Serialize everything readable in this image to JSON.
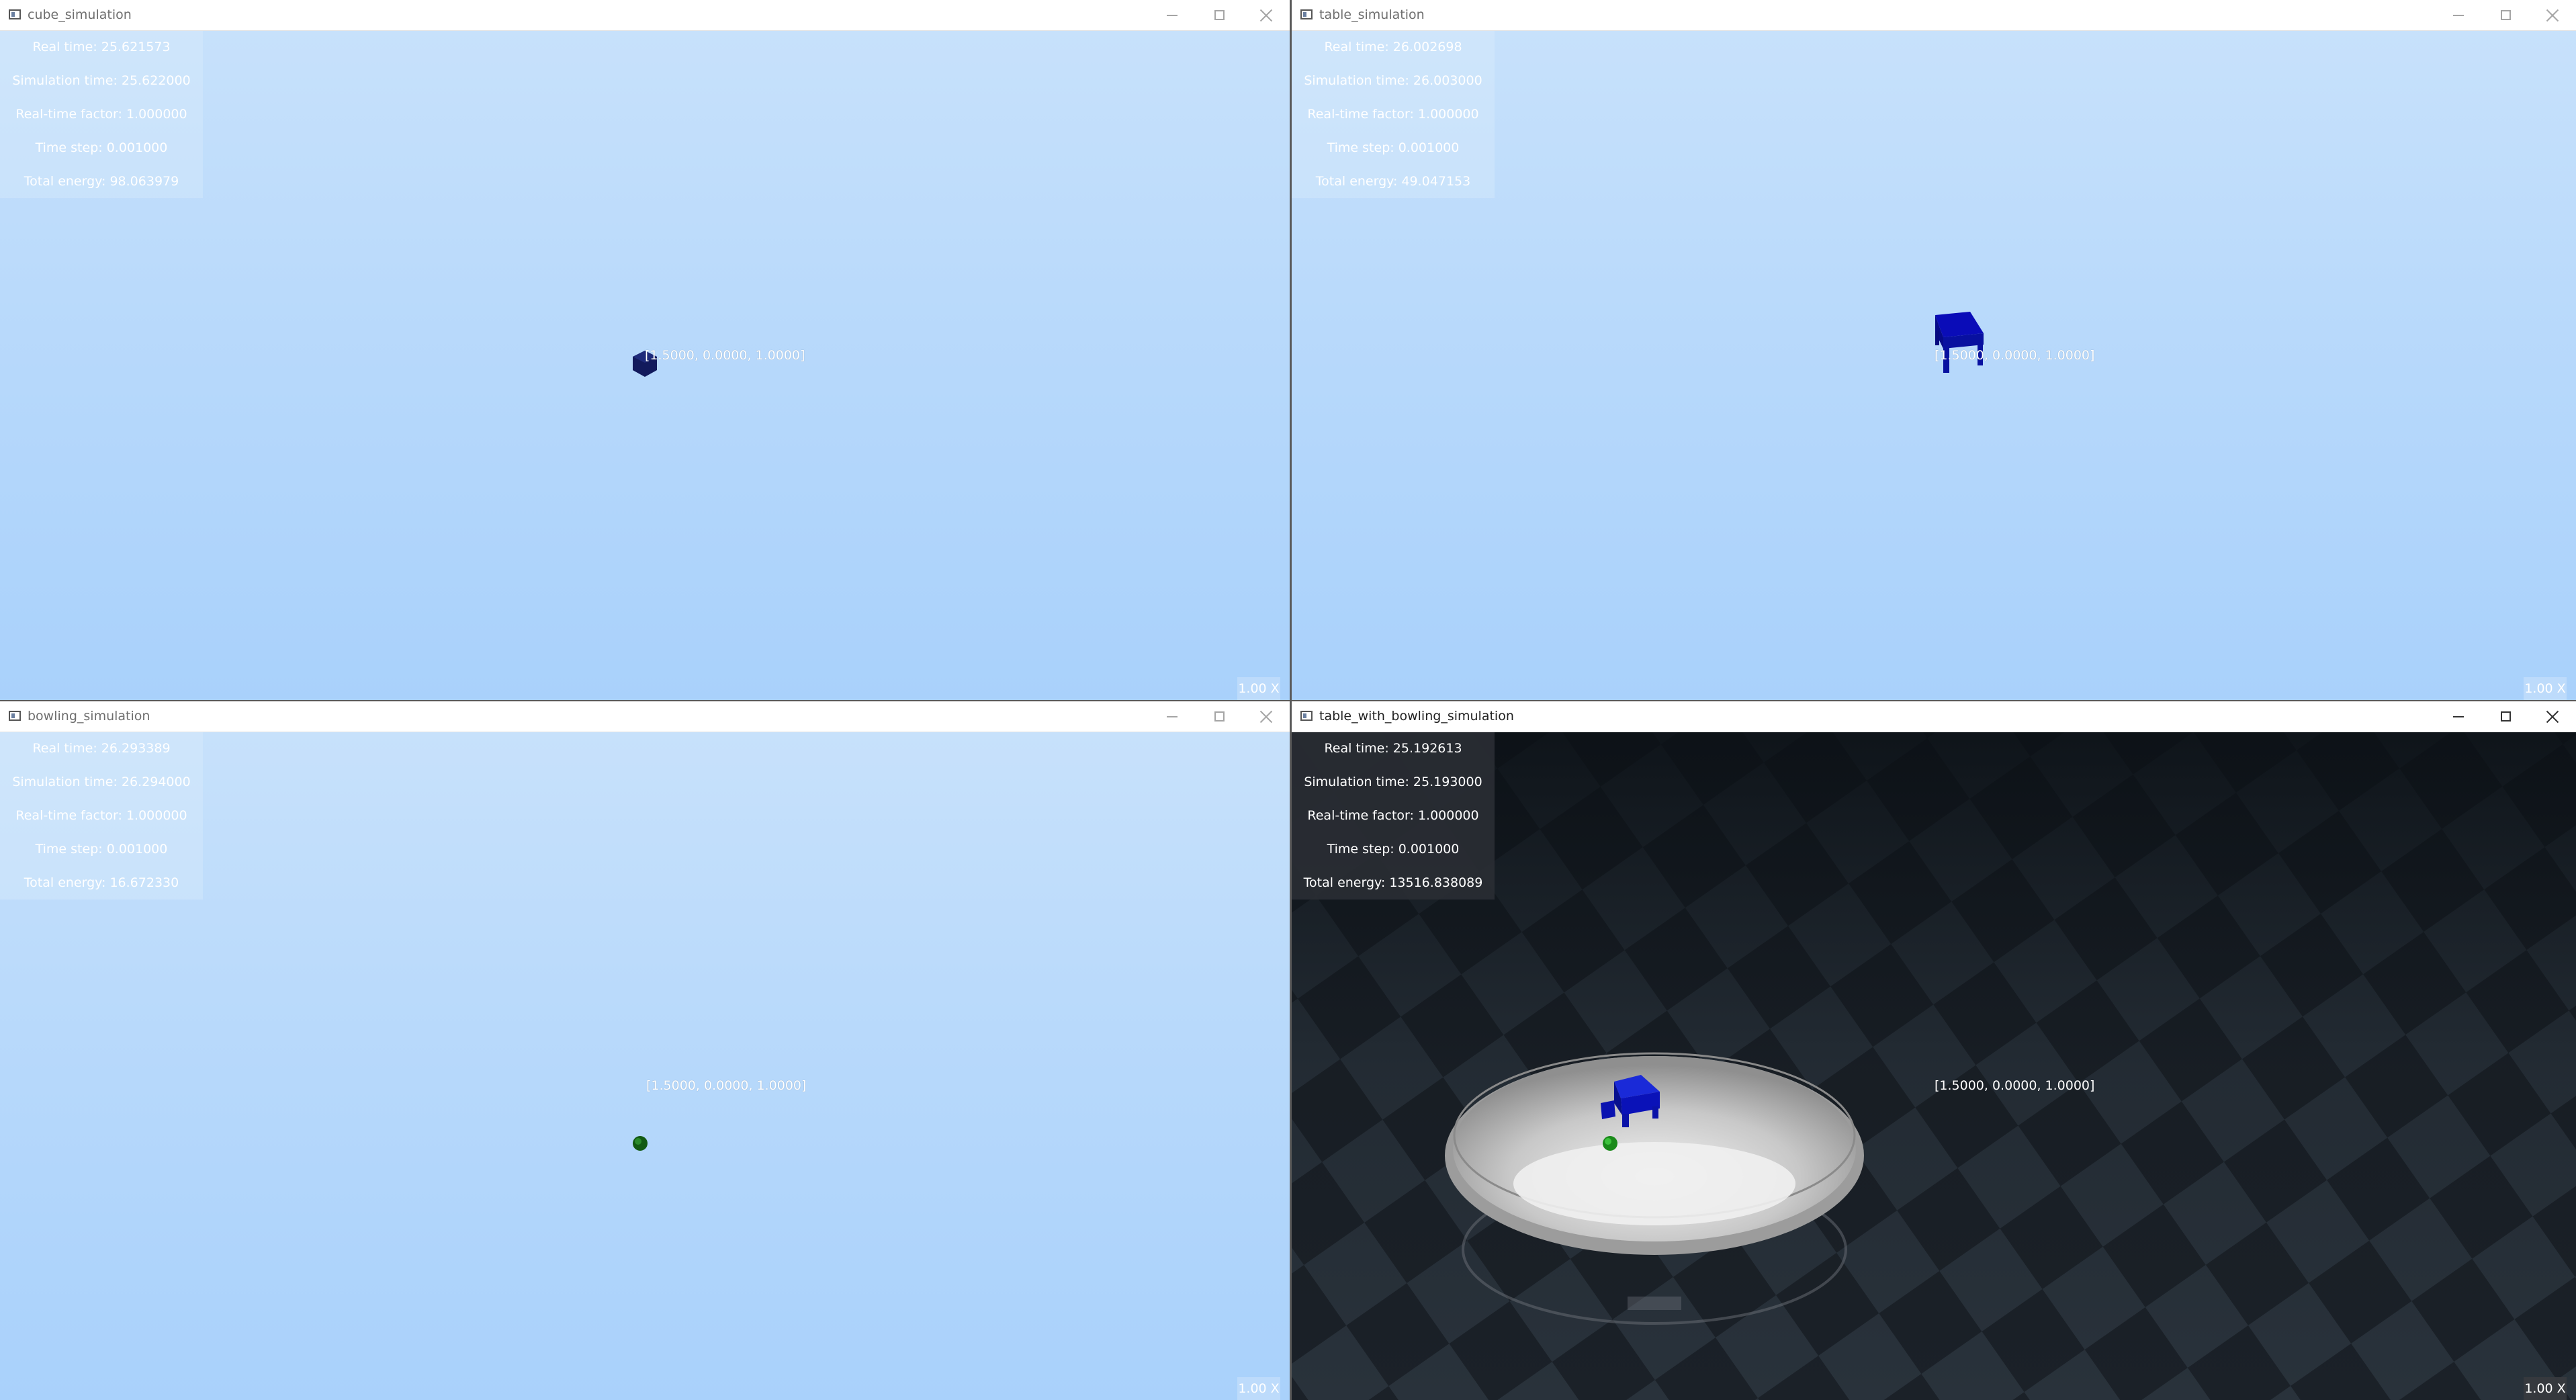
{
  "windows": {
    "top_left": {
      "title": "cube_simulation",
      "stats": {
        "real_time": "Real time: 25.621573",
        "simulation_time": "Simulation time: 25.622000",
        "real_time_factor": "Real-time factor: 1.000000",
        "time_step": "Time step: 0.001000",
        "total_energy": "Total energy: 98.063979"
      },
      "coordinate": "[1.5000, 0.0000, 1.0000]",
      "zoom": "1.00 X",
      "object_icon": "cube-icon"
    },
    "top_right": {
      "title": "table_simulation",
      "stats": {
        "real_time": "Real time: 26.002698",
        "simulation_time": "Simulation time: 26.003000",
        "real_time_factor": "Real-time factor: 1.000000",
        "time_step": "Time step: 0.001000",
        "total_energy": "Total energy: 49.047153"
      },
      "coordinate": "[1.5000, 0.0000, 1.0000]",
      "zoom": "1.00 X",
      "object_icon": "table-icon"
    },
    "bottom_left": {
      "title": "bowling_simulation",
      "stats": {
        "real_time": "Real time: 26.293389",
        "simulation_time": "Simulation time: 26.294000",
        "real_time_factor": "Real-time factor: 1.000000",
        "time_step": "Time step: 0.001000",
        "total_energy": "Total energy: 16.672330"
      },
      "coordinate": "[1.5000, 0.0000, 1.0000]",
      "zoom": "1.00 X",
      "object_icon": "ball-icon"
    },
    "bottom_right": {
      "title": "table_with_bowling_simulation",
      "stats": {
        "real_time": "Real time: 25.192613",
        "simulation_time": "Simulation time: 25.193000",
        "real_time_factor": "Real-time factor: 1.000000",
        "time_step": "Time step: 0.001000",
        "total_energy": "Total energy: 13516.838089"
      },
      "coordinate": "[1.5000, 0.0000, 1.0000]",
      "zoom": "1.00 X",
      "object_icon": "bowl-scene-icon"
    }
  },
  "colors": {
    "sky_top": "#c7e1fb",
    "sky_bottom": "#a9d1fb",
    "object_blue": "#0a0cc8",
    "cube_navy": "#121a5c",
    "ball_green": "#1a8a1a",
    "floor_dark": "#1c242b"
  }
}
